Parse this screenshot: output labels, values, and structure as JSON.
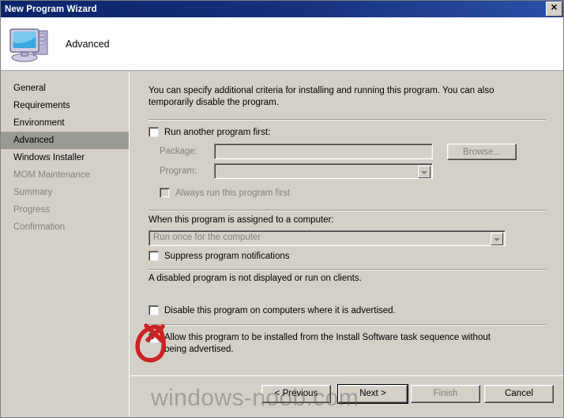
{
  "window": {
    "title": "New Program Wizard",
    "close_icon": "close-icon",
    "close_glyph": "✕"
  },
  "header": {
    "icon": "computer-icon",
    "title": "Advanced"
  },
  "sidebar": {
    "items": [
      {
        "label": "General",
        "state": "normal"
      },
      {
        "label": "Requirements",
        "state": "normal"
      },
      {
        "label": "Environment",
        "state": "normal"
      },
      {
        "label": "Advanced",
        "state": "selected"
      },
      {
        "label": "Windows Installer",
        "state": "normal"
      },
      {
        "label": "MOM Maintenance",
        "state": "disabled"
      },
      {
        "label": "Summary",
        "state": "disabled"
      },
      {
        "label": "Progress",
        "state": "disabled"
      },
      {
        "label": "Confirmation",
        "state": "disabled"
      }
    ]
  },
  "content": {
    "intro": "You can specify additional criteria for installing and running this program. You can also temporarily disable the program.",
    "run_another": {
      "label": "Run another program first:",
      "checked": false
    },
    "package": {
      "label": "Package:",
      "value": "",
      "placeholder": ""
    },
    "program": {
      "label": "Program:",
      "value": "",
      "placeholder": ""
    },
    "browse_button": "Browse...",
    "always_run": {
      "label": "Always run this program first",
      "checked": false
    },
    "assigned_label": "When this program is assigned to a computer:",
    "assigned_value": "Run once for the computer",
    "suppress": {
      "label": "Suppress program notifications",
      "checked": false
    },
    "disabled_note": "A disabled program is not displayed or run on clients.",
    "disable_program": {
      "label": "Disable this program on computers where it is advertised.",
      "checked": false
    },
    "allow_install": {
      "label": "Allow this program to be installed from the Install Software task sequence without being advertised.",
      "checked": true,
      "check_glyph": "✔"
    }
  },
  "footer": {
    "previous": "< Previous",
    "next": "Next >",
    "finish": "Finish",
    "cancel": "Cancel"
  },
  "watermark": "windows-noob.com",
  "colors": {
    "titlebar_start": "#0a246a",
    "titlebar_end": "#2c50a8",
    "dialog_face": "#d4d0c8",
    "selected_nav": "#9a9a94",
    "disabled_text": "#868079",
    "annotation_red": "#cc2222"
  }
}
